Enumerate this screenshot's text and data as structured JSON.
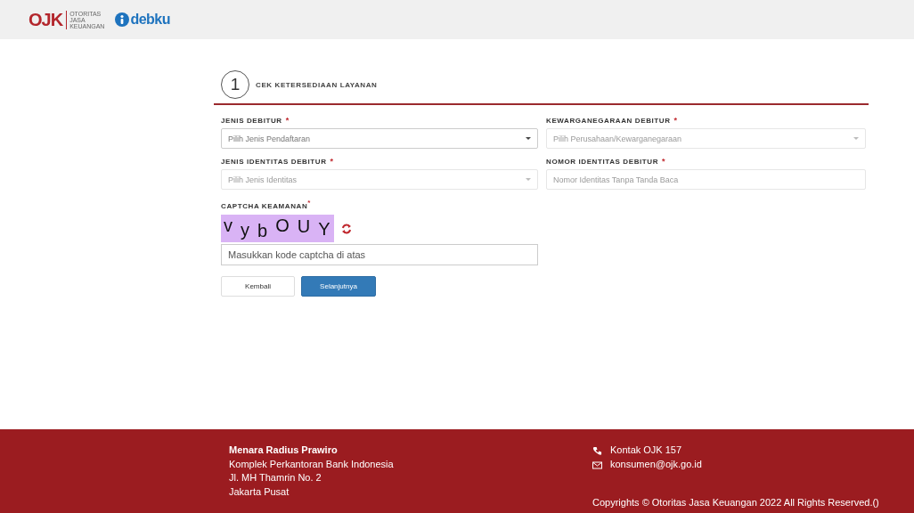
{
  "header": {
    "ojk_logo": {
      "mark": "OJK",
      "lines": [
        "OTORITAS",
        "JASA",
        "KEUANGAN"
      ]
    },
    "app_logo": {
      "text": "debku"
    }
  },
  "step": {
    "number": "1",
    "title": "CEK KETERSEDIAAN LAYANAN"
  },
  "fields": [
    {
      "label": "JENIS DEBITUR",
      "required": "*",
      "kind": "select",
      "placeholder": "Pilih Jenis Pendaftaran",
      "disabled": false
    },
    {
      "label": "KEWARGANEGARAAN DEBITUR",
      "required": "*",
      "kind": "select",
      "placeholder": "Pilih Perusahaan/Kewarganegaraan",
      "disabled": true
    },
    {
      "label": "JENIS IDENTITAS DEBITUR",
      "required": "*",
      "kind": "select",
      "placeholder": "Pilih Jenis Identitas",
      "disabled": true
    },
    {
      "label": "NOMOR IDENTITAS DEBITUR",
      "required": "*",
      "kind": "text",
      "placeholder": "Nomor Identitas Tanpa Tanda Baca",
      "disabled": true
    }
  ],
  "captcha": {
    "label": "CAPTCHA KEAMANAN",
    "required": "*",
    "code": [
      "v",
      "y",
      "b",
      "O",
      "U",
      "Y"
    ],
    "placeholder": "Masukkan kode captcha di atas"
  },
  "buttons": [
    {
      "label": "Kembali",
      "kind": "secondary"
    },
    {
      "label": "Selanjutnya",
      "kind": "primary"
    }
  ],
  "footer": {
    "address": [
      "Menara Radius Prawiro",
      "Komplek Perkantoran Bank Indonesia",
      "Jl. MH Thamrin No. 2",
      "Jakarta Pusat"
    ],
    "contacts": [
      {
        "kind": "phone",
        "text": "Kontak OJK 157"
      },
      {
        "kind": "email",
        "text": "konsumen@ojk.go.id"
      }
    ],
    "copyright": "Copyrights © Otoritas Jasa Keuangan 2022 All Rights Reserved.()"
  }
}
